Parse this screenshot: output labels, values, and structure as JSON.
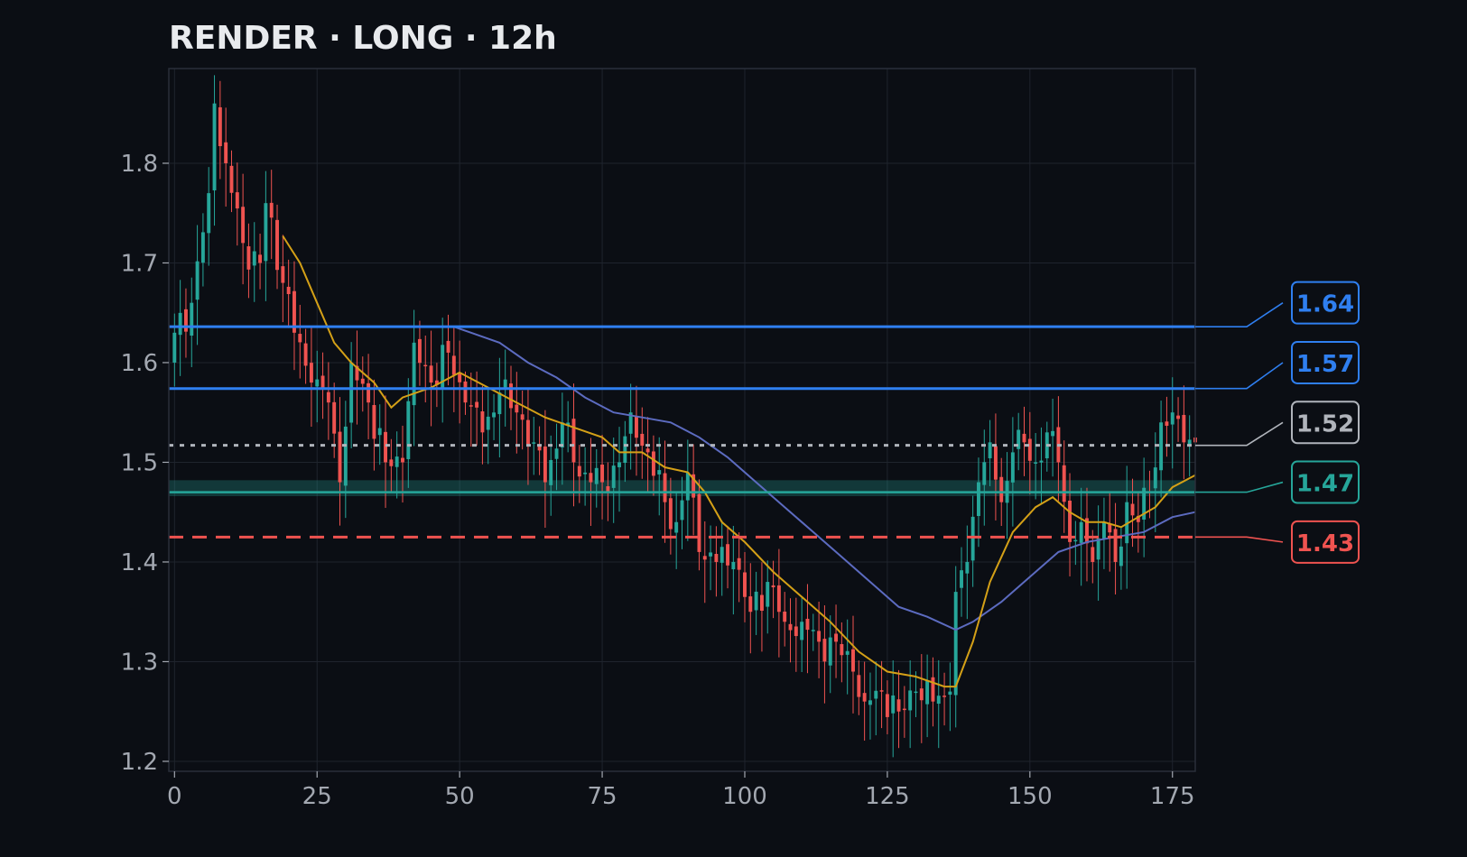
{
  "chart_data": {
    "type": "candlestick",
    "title": "RENDER · LONG · 12h",
    "xlim": [
      -1,
      179
    ],
    "ylim": [
      1.19,
      1.895
    ],
    "x_ticks": [
      0,
      25,
      50,
      75,
      100,
      125,
      150,
      175
    ],
    "y_ticks": [
      1.2,
      1.3,
      1.4,
      1.5,
      1.6,
      1.7,
      1.8
    ],
    "grid": true,
    "colors": {
      "background": "#0b0e14",
      "plot_border": "#2a2f3a",
      "grid": "#1f242d",
      "up": "#26a69a",
      "down": "#ef5350",
      "ma_fast": "#d4a017",
      "ma_slow": "#5c6bc0"
    },
    "levels": [
      {
        "label": "1.64",
        "value": 1.636,
        "color": "#2f7ff0",
        "style": "solid",
        "label_y": 1.66
      },
      {
        "label": "1.57",
        "value": 1.574,
        "color": "#2f7ff0",
        "style": "solid",
        "label_y": 1.6
      },
      {
        "label": "1.52",
        "value": 1.517,
        "color": "#b0b4bb",
        "style": "dotted",
        "label_y": 1.54
      },
      {
        "label": "1.47",
        "value": 1.47,
        "color": "#26a69a",
        "style": "zone",
        "zone": [
          1.466,
          1.482
        ],
        "label_y": 1.48
      },
      {
        "label": "1.43",
        "value": 1.425,
        "color": "#ef5350",
        "style": "dashed",
        "label_y": 1.42
      }
    ],
    "close_anchors": [
      [
        0,
        1.63
      ],
      [
        3,
        1.66
      ],
      [
        6,
        1.77
      ],
      [
        7,
        1.86
      ],
      [
        9,
        1.8
      ],
      [
        12,
        1.72
      ],
      [
        15,
        1.7
      ],
      [
        16,
        1.76
      ],
      [
        19,
        1.68
      ],
      [
        21,
        1.63
      ],
      [
        24,
        1.58
      ],
      [
        27,
        1.56
      ],
      [
        29,
        1.48
      ],
      [
        31,
        1.6
      ],
      [
        34,
        1.56
      ],
      [
        37,
        1.5
      ],
      [
        40,
        1.5
      ],
      [
        42,
        1.62
      ],
      [
        45,
        1.58
      ],
      [
        48,
        1.61
      ],
      [
        51,
        1.56
      ],
      [
        54,
        1.53
      ],
      [
        57,
        1.57
      ],
      [
        60,
        1.55
      ],
      [
        63,
        1.52
      ],
      [
        65,
        1.48
      ],
      [
        68,
        1.54
      ],
      [
        70,
        1.5
      ],
      [
        73,
        1.48
      ],
      [
        75,
        1.48
      ],
      [
        78,
        1.5
      ],
      [
        80,
        1.55
      ],
      [
        83,
        1.51
      ],
      [
        86,
        1.46
      ],
      [
        88,
        1.44
      ],
      [
        90,
        1.49
      ],
      [
        92,
        1.41
      ],
      [
        95,
        1.4
      ],
      [
        98,
        1.4
      ],
      [
        101,
        1.35
      ],
      [
        104,
        1.38
      ],
      [
        107,
        1.34
      ],
      [
        110,
        1.34
      ],
      [
        113,
        1.32
      ],
      [
        116,
        1.32
      ],
      [
        119,
        1.29
      ],
      [
        121,
        1.26
      ],
      [
        124,
        1.27
      ],
      [
        127,
        1.25
      ],
      [
        130,
        1.27
      ],
      [
        133,
        1.26
      ],
      [
        136,
        1.27
      ],
      [
        137,
        1.37
      ],
      [
        139,
        1.4
      ],
      [
        141,
        1.48
      ],
      [
        143,
        1.52
      ],
      [
        145,
        1.46
      ],
      [
        147,
        1.51
      ],
      [
        149,
        1.52
      ],
      [
        151,
        1.5
      ],
      [
        153,
        1.53
      ],
      [
        155,
        1.5
      ],
      [
        157,
        1.42
      ],
      [
        159,
        1.44
      ],
      [
        161,
        1.4
      ],
      [
        163,
        1.44
      ],
      [
        165,
        1.4
      ],
      [
        167,
        1.46
      ],
      [
        169,
        1.44
      ],
      [
        171,
        1.47
      ],
      [
        173,
        1.54
      ],
      [
        175,
        1.55
      ],
      [
        177,
        1.52
      ],
      [
        179,
        1.52
      ]
    ],
    "ma_fast": [
      [
        19,
        1.727
      ],
      [
        22,
        1.7
      ],
      [
        25,
        1.66
      ],
      [
        28,
        1.62
      ],
      [
        31,
        1.6
      ],
      [
        35,
        1.58
      ],
      [
        38,
        1.555
      ],
      [
        40,
        1.565
      ],
      [
        45,
        1.575
      ],
      [
        50,
        1.59
      ],
      [
        55,
        1.575
      ],
      [
        60,
        1.56
      ],
      [
        65,
        1.545
      ],
      [
        70,
        1.535
      ],
      [
        75,
        1.525
      ],
      [
        78,
        1.51
      ],
      [
        82,
        1.51
      ],
      [
        86,
        1.495
      ],
      [
        90,
        1.49
      ],
      [
        93,
        1.47
      ],
      [
        96,
        1.44
      ],
      [
        100,
        1.42
      ],
      [
        105,
        1.39
      ],
      [
        110,
        1.365
      ],
      [
        115,
        1.34
      ],
      [
        120,
        1.31
      ],
      [
        125,
        1.29
      ],
      [
        130,
        1.285
      ],
      [
        135,
        1.275
      ],
      [
        137,
        1.275
      ],
      [
        140,
        1.32
      ],
      [
        143,
        1.38
      ],
      [
        147,
        1.43
      ],
      [
        151,
        1.455
      ],
      [
        154,
        1.465
      ],
      [
        157,
        1.45
      ],
      [
        160,
        1.44
      ],
      [
        163,
        1.44
      ],
      [
        166,
        1.435
      ],
      [
        169,
        1.445
      ],
      [
        172,
        1.455
      ],
      [
        175,
        1.475
      ],
      [
        179,
        1.487
      ]
    ],
    "ma_slow": [
      [
        49,
        1.636
      ],
      [
        52,
        1.63
      ],
      [
        57,
        1.62
      ],
      [
        62,
        1.6
      ],
      [
        67,
        1.585
      ],
      [
        72,
        1.565
      ],
      [
        77,
        1.55
      ],
      [
        82,
        1.545
      ],
      [
        87,
        1.54
      ],
      [
        92,
        1.525
      ],
      [
        97,
        1.505
      ],
      [
        102,
        1.48
      ],
      [
        107,
        1.455
      ],
      [
        112,
        1.43
      ],
      [
        117,
        1.405
      ],
      [
        122,
        1.38
      ],
      [
        127,
        1.355
      ],
      [
        132,
        1.345
      ],
      [
        137,
        1.332
      ],
      [
        140,
        1.34
      ],
      [
        145,
        1.36
      ],
      [
        150,
        1.385
      ],
      [
        155,
        1.41
      ],
      [
        160,
        1.42
      ],
      [
        165,
        1.425
      ],
      [
        170,
        1.43
      ],
      [
        175,
        1.445
      ],
      [
        179,
        1.45
      ]
    ]
  }
}
